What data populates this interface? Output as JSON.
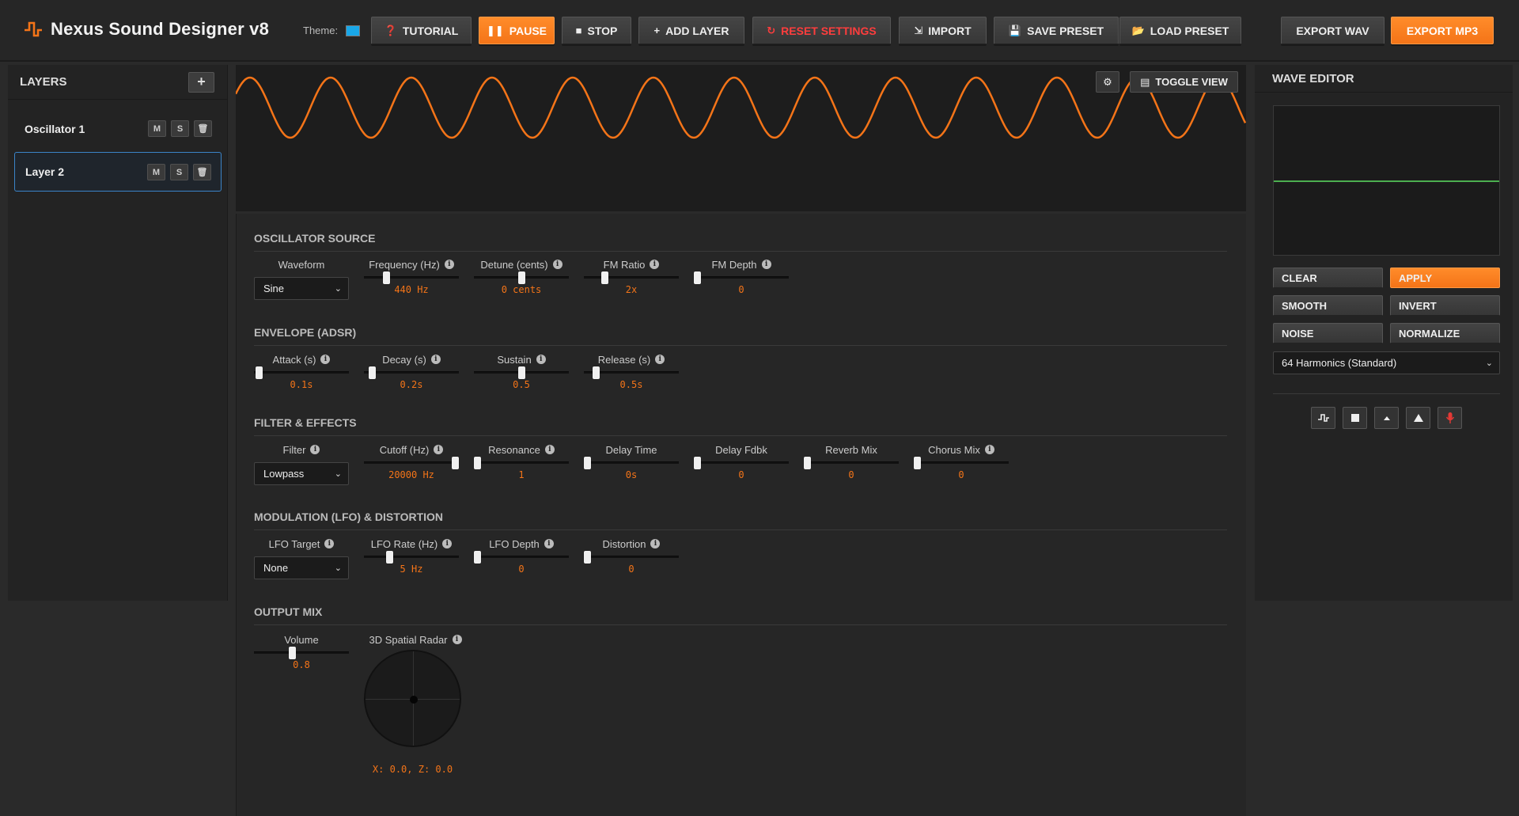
{
  "app": {
    "title": "Nexus Sound Designer v8",
    "theme_label": "Theme:",
    "theme_color": "#19a7e8",
    "accent": "#f47418"
  },
  "toolbar": {
    "tutorial": "TUTORIAL",
    "pause": "PAUSE",
    "stop": "STOP",
    "add_layer": "ADD LAYER",
    "reset_settings": "RESET SETTINGS",
    "import": "IMPORT",
    "save_preset": "SAVE PRESET",
    "load_preset": "LOAD PRESET",
    "export_wav": "EXPORT WAV",
    "export_mp3": "EXPORT MP3"
  },
  "layers": {
    "title": "LAYERS",
    "add": "+",
    "items": [
      {
        "name": "Oscillator 1",
        "mute": "M",
        "solo": "S",
        "selected": false
      },
      {
        "name": "Layer 2",
        "mute": "M",
        "solo": "S",
        "selected": true
      }
    ]
  },
  "visualizer": {
    "toggle_view": "TOGGLE VIEW",
    "waveform": "sine",
    "cycles": 10
  },
  "sections": {
    "osc": "OSCILLATOR SOURCE",
    "env": "ENVELOPE (ADSR)",
    "filter": "FILTER & EFFECTS",
    "mod": "MODULATION (LFO) & DISTORTION",
    "out": "OUTPUT MIX"
  },
  "osc": {
    "waveform": {
      "label": "Waveform",
      "value": "Sine"
    },
    "frequency": {
      "label": "Frequency (Hz)",
      "value": "440 Hz",
      "level": 0.22
    },
    "detune": {
      "label": "Detune (cents)",
      "value": "0 cents",
      "level": 0.5
    },
    "fm_ratio": {
      "label": "FM Ratio",
      "value": "2x",
      "level": 0.2
    },
    "fm_depth": {
      "label": "FM Depth",
      "value": "0",
      "level": 0
    }
  },
  "env": {
    "attack": {
      "label": "Attack (s)",
      "value": "0.1s",
      "level": 0.02
    },
    "decay": {
      "label": "Decay (s)",
      "value": "0.2s",
      "level": 0.05
    },
    "sustain": {
      "label": "Sustain",
      "value": "0.5",
      "level": 0.5
    },
    "release": {
      "label": "Release (s)",
      "value": "0.5s",
      "level": 0.1
    }
  },
  "fx": {
    "filter": {
      "label": "Filter",
      "value": "Lowpass"
    },
    "cutoff": {
      "label": "Cutoff (Hz)",
      "value": "20000 Hz",
      "level": 1
    },
    "resonance": {
      "label": "Resonance",
      "value": "1",
      "level": 0
    },
    "delay_time": {
      "label": "Delay Time",
      "value": "0s",
      "level": 0
    },
    "delay_fdbk": {
      "label": "Delay Fdbk",
      "value": "0",
      "level": 0
    },
    "reverb_mix": {
      "label": "Reverb Mix",
      "value": "0",
      "level": 0
    },
    "chorus_mix": {
      "label": "Chorus Mix",
      "value": "0",
      "level": 0
    }
  },
  "mod": {
    "lfo_target": {
      "label": "LFO Target",
      "value": "None"
    },
    "lfo_rate": {
      "label": "LFO Rate (Hz)",
      "value": "5 Hz",
      "level": 0.25
    },
    "lfo_depth": {
      "label": "LFO Depth",
      "value": "0",
      "level": 0
    },
    "distortion": {
      "label": "Distortion",
      "value": "0",
      "level": 0
    }
  },
  "out": {
    "volume": {
      "label": "Volume",
      "value": "0.8",
      "level": 0.4
    },
    "radar": {
      "label": "3D Spatial Radar",
      "value": "X: 0.0, Z: 0.0"
    }
  },
  "wave_editor": {
    "title": "WAVE EDITOR",
    "clear": "CLEAR",
    "apply": "APPLY",
    "smooth": "SMOOTH",
    "invert": "INVERT",
    "noise": "NOISE",
    "normalize": "NORMALIZE",
    "harmonics": "64 Harmonics (Standard)",
    "tools": [
      "square-wave-icon",
      "stop-square-icon",
      "small-triangle-icon",
      "triangle-icon",
      "microphone-icon"
    ]
  }
}
